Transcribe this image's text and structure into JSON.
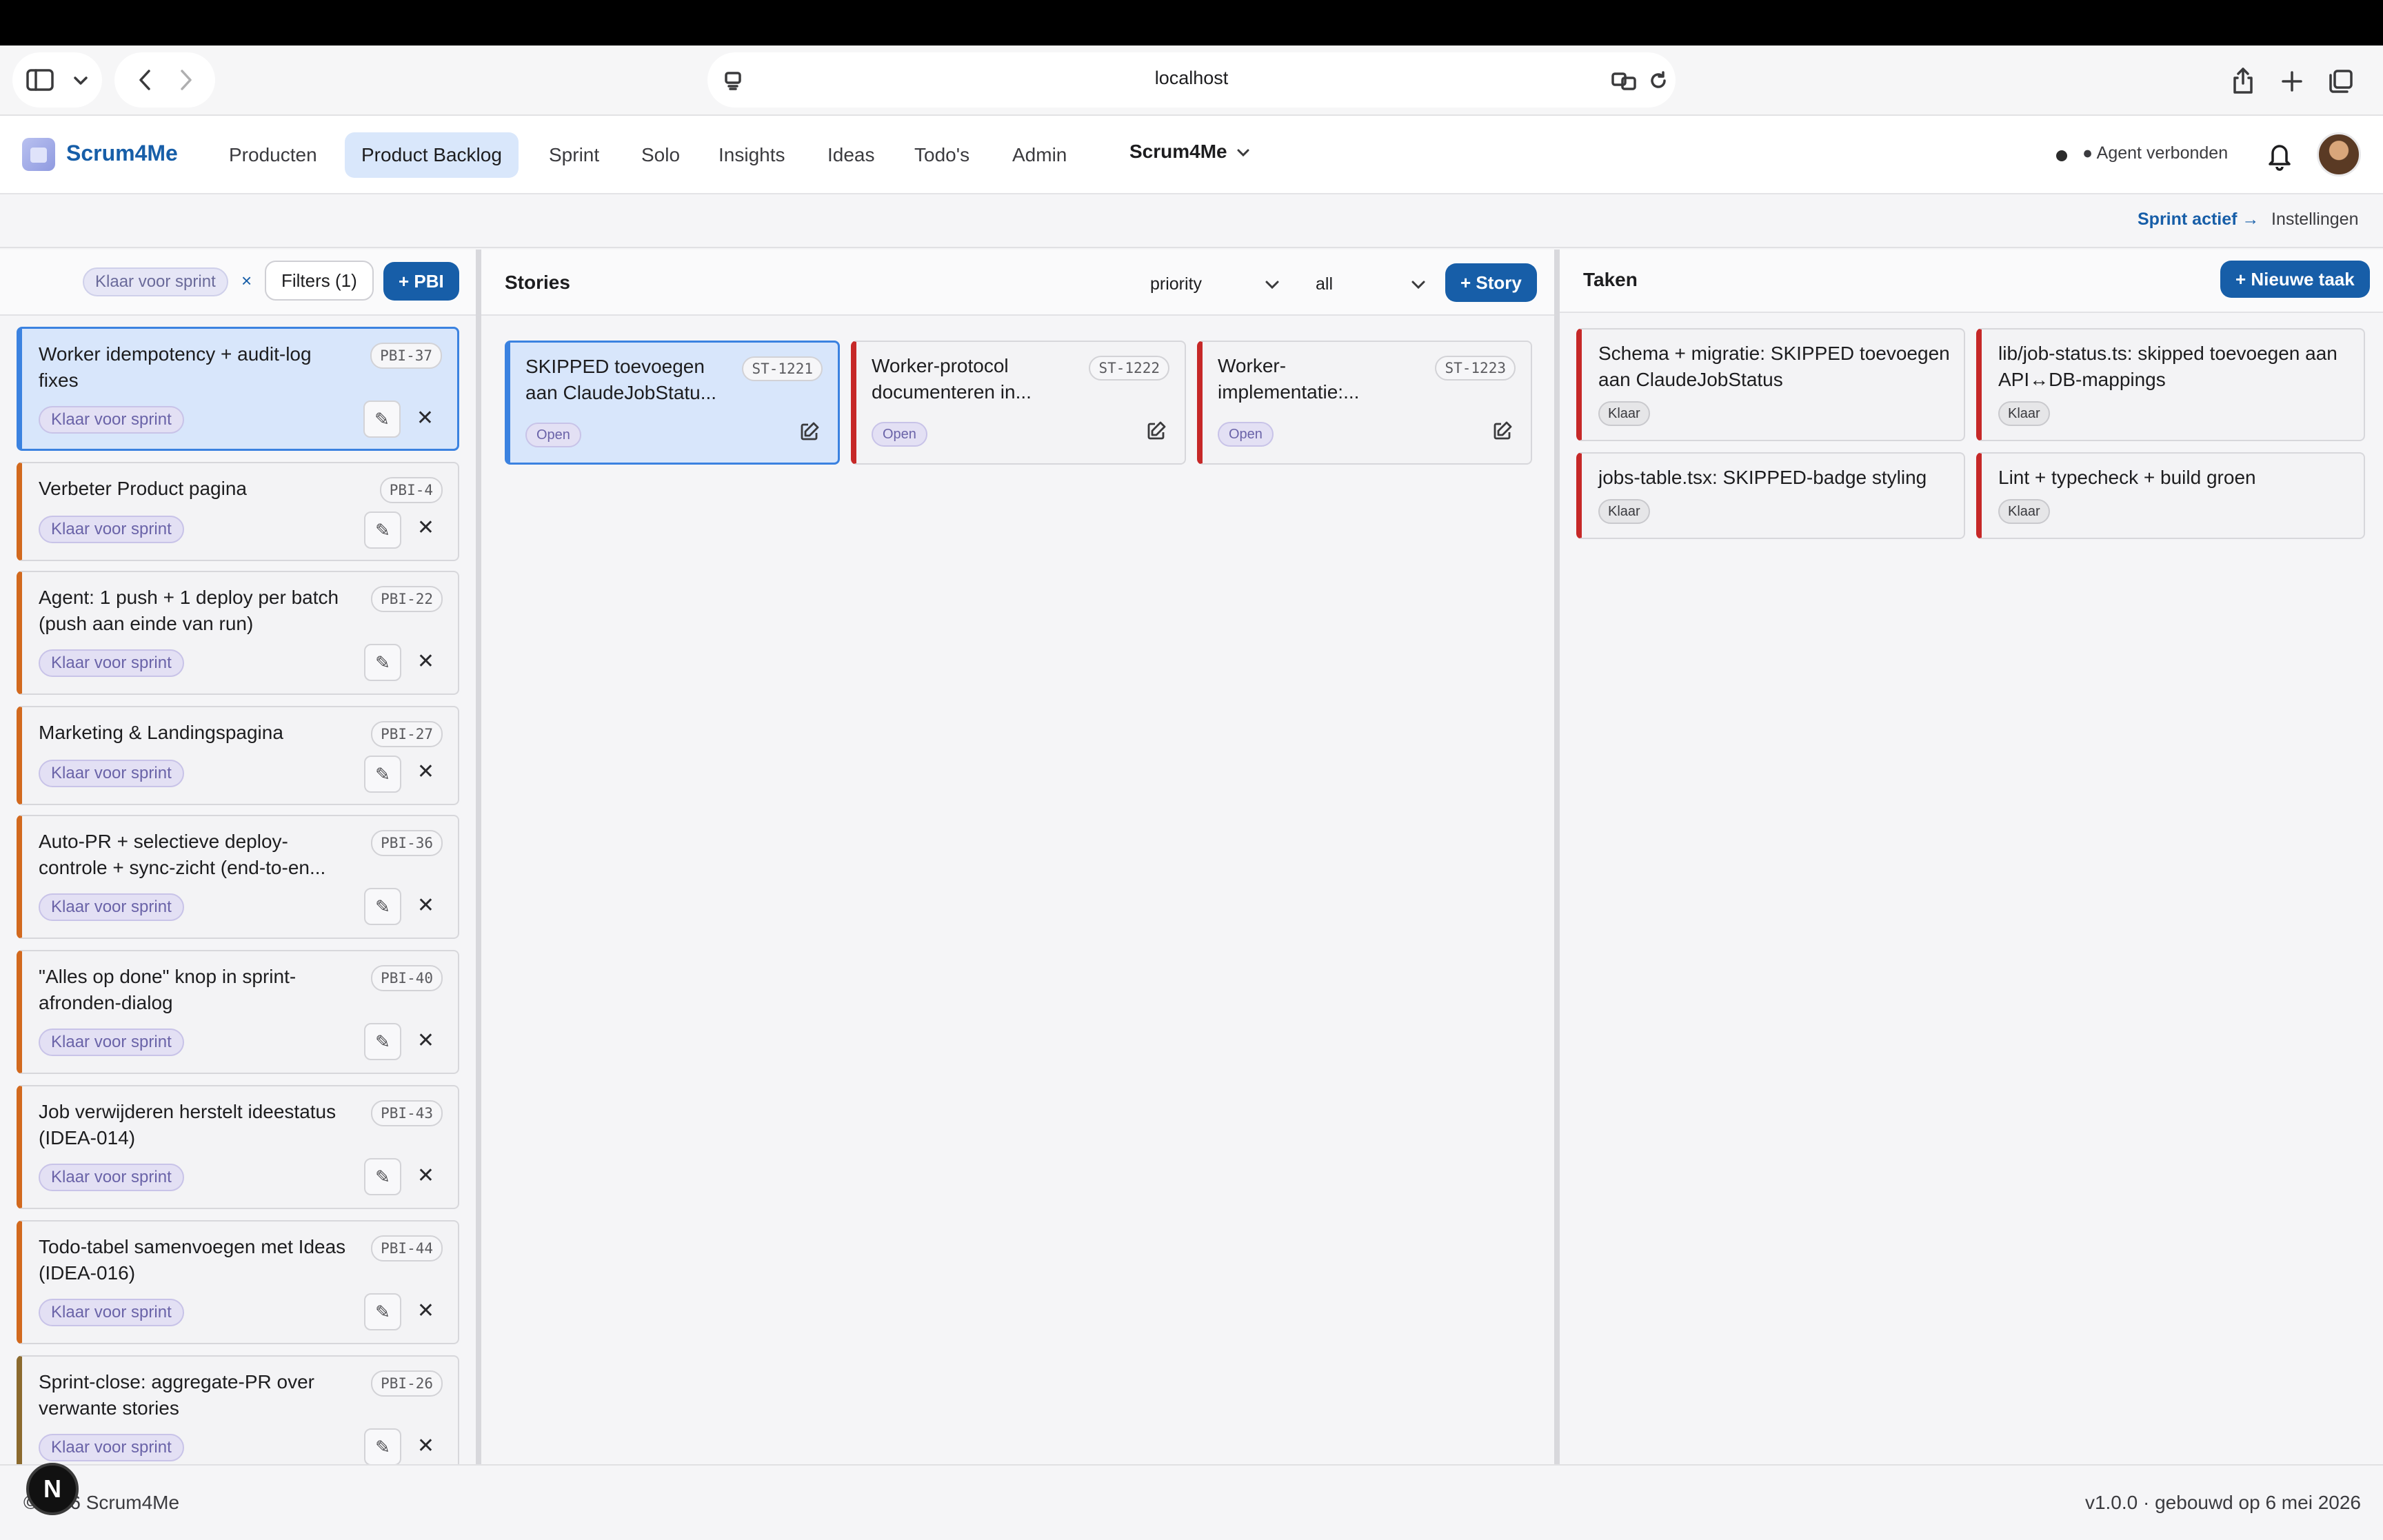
{
  "browser": {
    "url": "localhost"
  },
  "header": {
    "brand": "Scrum4Me",
    "nav": [
      {
        "label": "Producten"
      },
      {
        "label": "Product Backlog"
      },
      {
        "label": "Sprint"
      },
      {
        "label": "Solo"
      },
      {
        "label": "Insights"
      },
      {
        "label": "Ideas"
      },
      {
        "label": "Todo's"
      },
      {
        "label": "Admin"
      }
    ],
    "workspace": "Scrum4Me",
    "agent_status": "● Agent verbonden"
  },
  "subbar": {
    "sprint_active": "Sprint actief →",
    "settings": "Instellingen"
  },
  "pbi_panel": {
    "active_filter": "Klaar voor sprint",
    "clear_filter": "×",
    "filters_button": "Filters (1)",
    "add_button": "+ PBI",
    "items": [
      {
        "title": "Worker idempotency + audit-log fixes",
        "code": "PBI-37",
        "status": "Klaar voor sprint"
      },
      {
        "title": "Verbeter Product pagina",
        "code": "PBI-4",
        "status": "Klaar voor sprint"
      },
      {
        "title": "Agent: 1 push + 1 deploy per batch (push aan einde van run)",
        "code": "PBI-22",
        "status": "Klaar voor sprint"
      },
      {
        "title": "Marketing & Landingspagina",
        "code": "PBI-27",
        "status": "Klaar voor sprint"
      },
      {
        "title": "Auto-PR + selectieve deploy-controle + sync-zicht (end-to-en...",
        "code": "PBI-36",
        "status": "Klaar voor sprint"
      },
      {
        "title": "\"Alles op done\" knop in sprint-afronden-dialog",
        "code": "PBI-40",
        "status": "Klaar voor sprint"
      },
      {
        "title": "Job verwijderen herstelt ideestatus (IDEA-014)",
        "code": "PBI-43",
        "status": "Klaar voor sprint"
      },
      {
        "title": "Todo-tabel samenvoegen met Ideas (IDEA-016)",
        "code": "PBI-44",
        "status": "Klaar voor sprint"
      },
      {
        "title": "Sprint-close: aggregate-PR over verwante stories",
        "code": "PBI-26",
        "status": "Klaar voor sprint"
      }
    ]
  },
  "stories_panel": {
    "title": "Stories",
    "sort": "priority",
    "filter": "all",
    "add_button": "+ Story",
    "items": [
      {
        "title": "SKIPPED toevoegen aan ClaudeJobStatu...",
        "code": "ST-1221",
        "status": "Open"
      },
      {
        "title": "Worker-protocol documenteren in...",
        "code": "ST-1222",
        "status": "Open"
      },
      {
        "title": "Worker-implementatie:...",
        "code": "ST-1223",
        "status": "Open"
      }
    ]
  },
  "tasks_panel": {
    "title": "Taken",
    "add_button": "+ Nieuwe taak",
    "items": [
      {
        "title": "Schema + migratie: SKIPPED toevoegen aan ClaudeJobStatus",
        "status": "Klaar"
      },
      {
        "title": "lib/job-status.ts: skipped toevoegen aan API↔DB-mappings",
        "status": "Klaar"
      },
      {
        "title": "jobs-table.tsx: SKIPPED-badge styling",
        "status": "Klaar"
      },
      {
        "title": "Lint + typecheck + build groen",
        "status": "Klaar"
      }
    ]
  },
  "footer": {
    "copyright": "©2026 Scrum4Me",
    "version": "v1.0.0 · gebouwd op 6 mei 2026",
    "dev_badge": "N"
  },
  "colors": {
    "accent": "#175ea8",
    "pbi_border": "#d2691e",
    "story_border": "#c62828",
    "selected_bg": "#d8e6fb"
  }
}
